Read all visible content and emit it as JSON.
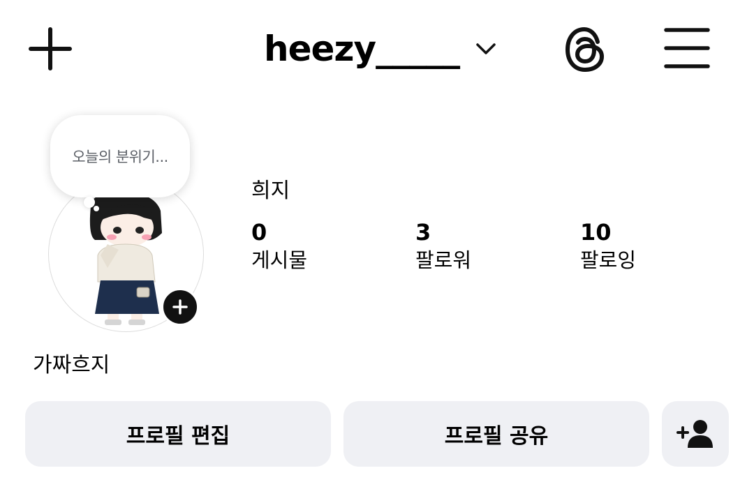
{
  "header": {
    "username": "heezy_____",
    "add_icon": "plus-icon",
    "dropdown_icon": "chevron-down-icon",
    "threads_icon": "threads-icon",
    "menu_icon": "hamburger-menu-icon"
  },
  "note": {
    "text": "오늘의 분위기..."
  },
  "profile": {
    "display_name": "희지",
    "bio_name": "가짜흐지",
    "stats": [
      {
        "value": "0",
        "label": "게시물"
      },
      {
        "value": "3",
        "label": "팔로워"
      },
      {
        "value": "10",
        "label": "팔로잉"
      }
    ]
  },
  "actions": {
    "edit_label": "프로필 편집",
    "share_label": "프로필 공유",
    "suggest_icon": "add-person-icon"
  },
  "colors": {
    "button_bg": "#eff0f4",
    "text": "#000000",
    "note_text": "#5b5f66"
  }
}
